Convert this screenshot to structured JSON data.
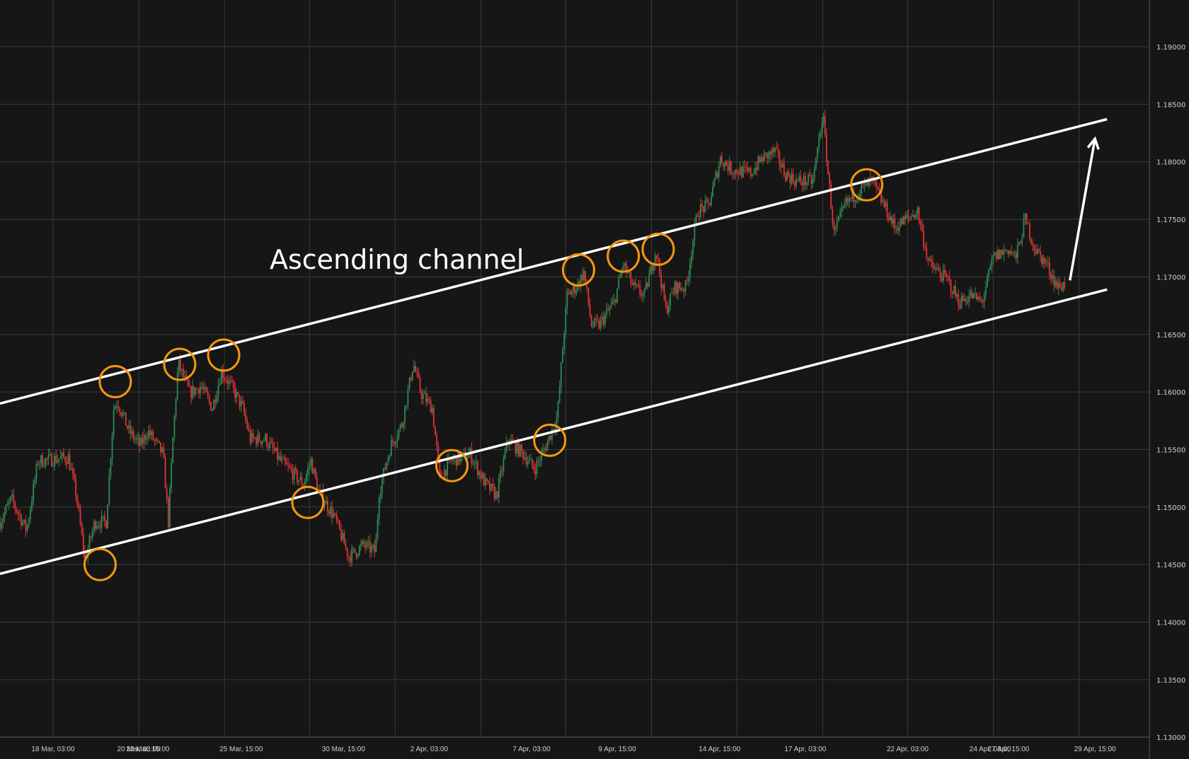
{
  "chart_data": {
    "type": "candlestick",
    "title": "",
    "annotation_text": "Ascending channel",
    "y_ticks": [
      "1.19000",
      "1.18500",
      "1.18000",
      "1.17500",
      "1.17000",
      "1.16500",
      "1.16000",
      "1.15500",
      "1.15000",
      "1.14500",
      "1.14000",
      "1.13500",
      "1.13000"
    ],
    "ylim": [
      1.13,
      1.1945
    ],
    "x_ticks": [
      "18 Mar, 03:00",
      "20 Mar, 03:00",
      "23 Mar, 15:00",
      "25 Mar, 15:00",
      "30 Mar, 15:00",
      "2 Apr, 03:00",
      "7 Apr, 03:00",
      "9 Apr, 15:00",
      "14 Apr, 15:00",
      "17 Apr, 03:00",
      "22 Apr, 03:00",
      "24 Apr, 03:00",
      "27 Apr, 15:00",
      "29 Apr, 15:00"
    ],
    "price_path_bar_price": [
      [
        0,
        1.1487
      ],
      [
        15,
        1.1507
      ],
      [
        35,
        1.148
      ],
      [
        50,
        1.154
      ],
      [
        90,
        1.1543
      ],
      [
        100,
        1.1513
      ],
      [
        112,
        1.1454
      ],
      [
        125,
        1.1487
      ],
      [
        140,
        1.1487
      ],
      [
        150,
        1.1586
      ],
      [
        155,
        1.1592
      ],
      [
        170,
        1.1566
      ],
      [
        185,
        1.1553
      ],
      [
        195,
        1.1566
      ],
      [
        215,
        1.1546
      ],
      [
        222,
        1.1487
      ],
      [
        228,
        1.1559
      ],
      [
        235,
        1.1625
      ],
      [
        250,
        1.1599
      ],
      [
        265,
        1.1605
      ],
      [
        280,
        1.1586
      ],
      [
        292,
        1.1618
      ],
      [
        305,
        1.1605
      ],
      [
        320,
        1.1586
      ],
      [
        330,
        1.1559
      ],
      [
        350,
        1.1559
      ],
      [
        370,
        1.154
      ],
      [
        400,
        1.152
      ],
      [
        410,
        1.154
      ],
      [
        420,
        1.1513
      ],
      [
        440,
        1.1493
      ],
      [
        460,
        1.1457
      ],
      [
        480,
        1.1467
      ],
      [
        495,
        1.1461
      ],
      [
        500,
        1.1513
      ],
      [
        515,
        1.1553
      ],
      [
        530,
        1.1572
      ],
      [
        545,
        1.1625
      ],
      [
        555,
        1.1599
      ],
      [
        570,
        1.1586
      ],
      [
        580,
        1.1526
      ],
      [
        595,
        1.154
      ],
      [
        620,
        1.1546
      ],
      [
        640,
        1.152
      ],
      [
        655,
        1.151
      ],
      [
        670,
        1.1559
      ],
      [
        690,
        1.1546
      ],
      [
        705,
        1.1533
      ],
      [
        720,
        1.1553
      ],
      [
        735,
        1.1579
      ],
      [
        742,
        1.1638
      ],
      [
        748,
        1.1684
      ],
      [
        760,
        1.1691
      ],
      [
        770,
        1.1704
      ],
      [
        780,
        1.1658
      ],
      [
        790,
        1.1658
      ],
      [
        810,
        1.1678
      ],
      [
        822,
        1.1711
      ],
      [
        835,
        1.1691
      ],
      [
        850,
        1.1684
      ],
      [
        865,
        1.1724
      ],
      [
        878,
        1.1671
      ],
      [
        890,
        1.1691
      ],
      [
        905,
        1.1691
      ],
      [
        912,
        1.1724
      ],
      [
        920,
        1.1757
      ],
      [
        935,
        1.1763
      ],
      [
        950,
        1.1803
      ],
      [
        965,
        1.1793
      ],
      [
        990,
        1.179
      ],
      [
        1005,
        1.1803
      ],
      [
        1022,
        1.1809
      ],
      [
        1035,
        1.179
      ],
      [
        1050,
        1.1783
      ],
      [
        1072,
        1.1783
      ],
      [
        1085,
        1.1842
      ],
      [
        1092,
        1.179
      ],
      [
        1100,
        1.1737
      ],
      [
        1115,
        1.1763
      ],
      [
        1135,
        1.1776
      ],
      [
        1150,
        1.1783
      ],
      [
        1165,
        1.1763
      ],
      [
        1180,
        1.1743
      ],
      [
        1195,
        1.175
      ],
      [
        1210,
        1.1757
      ],
      [
        1225,
        1.1711
      ],
      [
        1250,
        1.1697
      ],
      [
        1265,
        1.1678
      ],
      [
        1280,
        1.1684
      ],
      [
        1295,
        1.1678
      ],
      [
        1310,
        1.1717
      ],
      [
        1330,
        1.1724
      ],
      [
        1340,
        1.1717
      ],
      [
        1352,
        1.175
      ],
      [
        1365,
        1.1724
      ],
      [
        1380,
        1.1711
      ],
      [
        1395,
        1.1691
      ],
      [
        1405,
        1.1694
      ]
    ],
    "channel_upper": [
      [
        0,
        1.159
      ],
      [
        1460,
        1.1837
      ]
    ],
    "channel_lower": [
      [
        0,
        1.1442
      ],
      [
        1460,
        1.1689
      ]
    ],
    "arrow": [
      [
        1411,
        1.1697
      ],
      [
        1444,
        1.182
      ]
    ],
    "touch_points": [
      [
        152,
        1.1609
      ],
      [
        237,
        1.1624
      ],
      [
        295,
        1.1632
      ],
      [
        132,
        1.145
      ],
      [
        406,
        1.1504
      ],
      [
        596,
        1.1536
      ],
      [
        725,
        1.1558
      ],
      [
        763,
        1.1706
      ],
      [
        822,
        1.1718
      ],
      [
        868,
        1.1724
      ],
      [
        1143,
        1.178
      ]
    ],
    "colors": {
      "background": "#161616",
      "grid": "#3a3a3a",
      "up": "#2e8b57",
      "down": "#e03535",
      "circle": "#f5980e",
      "line": "#ffffff"
    }
  }
}
